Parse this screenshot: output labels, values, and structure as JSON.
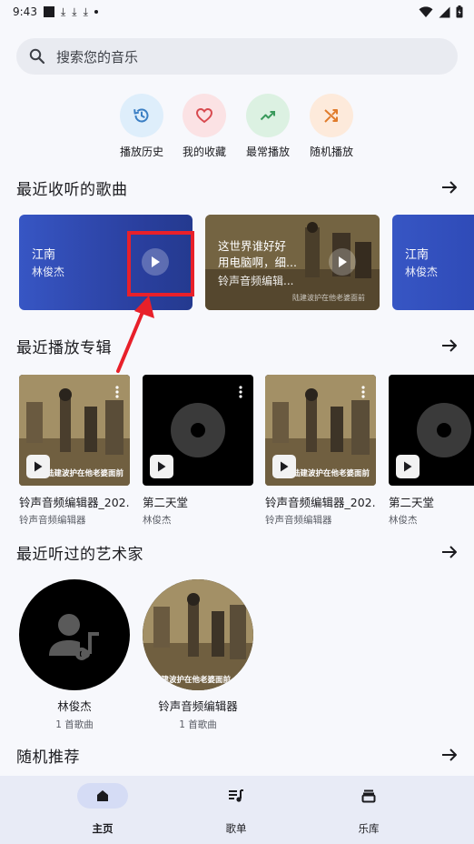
{
  "status_bar": {
    "time": "9:43",
    "download_glyph": "⤓"
  },
  "search": {
    "placeholder": "搜索您的音乐"
  },
  "quick_actions": [
    {
      "label": "播放历史",
      "icon": "history-icon",
      "bg": "#deeefb",
      "color": "#3b7fc4"
    },
    {
      "label": "我的收藏",
      "icon": "heart-icon",
      "bg": "#fbe2e4",
      "color": "#d84a4f"
    },
    {
      "label": "最常播放",
      "icon": "trending-up-icon",
      "bg": "#dcf1e2",
      "color": "#3a9a5c"
    },
    {
      "label": "随机播放",
      "icon": "shuffle-icon",
      "bg": "#fdeadb",
      "color": "#e07b2b"
    }
  ],
  "sections": {
    "recent_songs": "最近收听的歌曲",
    "recent_albums": "最近播放专辑",
    "recent_artists": "最近听过的艺术家",
    "random": "随机推荐"
  },
  "recent_songs": [
    {
      "title": "江南",
      "artist": "林俊杰"
    },
    {
      "title": "这世界谁好好用电脑啊，细...",
      "line1": "这世界谁好好",
      "line2": "用电脑啊，细...",
      "artist": "铃声音频编辑..."
    },
    {
      "title": "江南",
      "artist": "林俊杰"
    }
  ],
  "recent_albums": [
    {
      "name": "铃声音频编辑器_202...",
      "artist": "铃声音频编辑器",
      "cover": "photo"
    },
    {
      "name": "第二天堂",
      "artist": "林俊杰",
      "cover": "disc"
    },
    {
      "name": "铃声音频编辑器_202...",
      "artist": "铃声音频编辑器",
      "cover": "photo"
    },
    {
      "name": "第二天堂",
      "artist": "林俊杰",
      "cover": "disc"
    }
  ],
  "photo_caption": "陆建波护在他老婆面前",
  "recent_artists": [
    {
      "name": "林俊杰",
      "count": "1 首歌曲",
      "avatar": "placeholder"
    },
    {
      "name": "铃声音频编辑器",
      "count": "1 首歌曲",
      "avatar": "photo"
    }
  ],
  "bottom_nav": [
    {
      "label": "主页",
      "icon": "home-icon",
      "active": true
    },
    {
      "label": "歌单",
      "icon": "playlist-icon",
      "active": false
    },
    {
      "label": "乐库",
      "icon": "library-icon",
      "active": false
    }
  ],
  "colors": {
    "accent_red": "#e8202a",
    "song_card_blue": "#2f4bb8",
    "nav_bg": "#e8ebf6"
  }
}
